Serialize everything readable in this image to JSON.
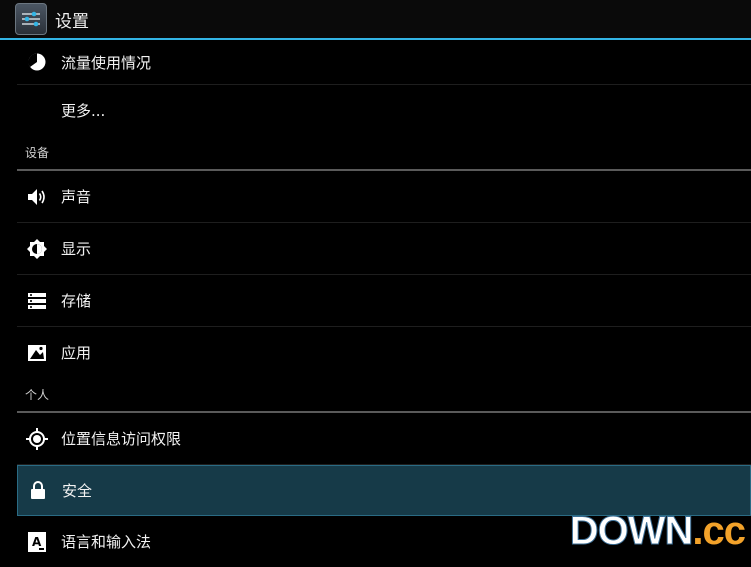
{
  "actionbar": {
    "title": "设置",
    "icon": "settings-sliders-icon"
  },
  "list": {
    "item_data_usage": "流量使用情况",
    "item_more": "更多...",
    "header_device": "设备",
    "item_sound": "声音",
    "item_display": "显示",
    "item_storage": "存储",
    "item_apps": "应用",
    "header_personal": "个人",
    "item_location": "位置信息访问权限",
    "item_security": "安全",
    "item_language": "语言和输入法"
  },
  "watermark": {
    "part1": "DOWN",
    "part2": ".cc"
  },
  "colors": {
    "accent": "#33b5e5",
    "selected_bg": "#163a48",
    "background": "#000000"
  }
}
